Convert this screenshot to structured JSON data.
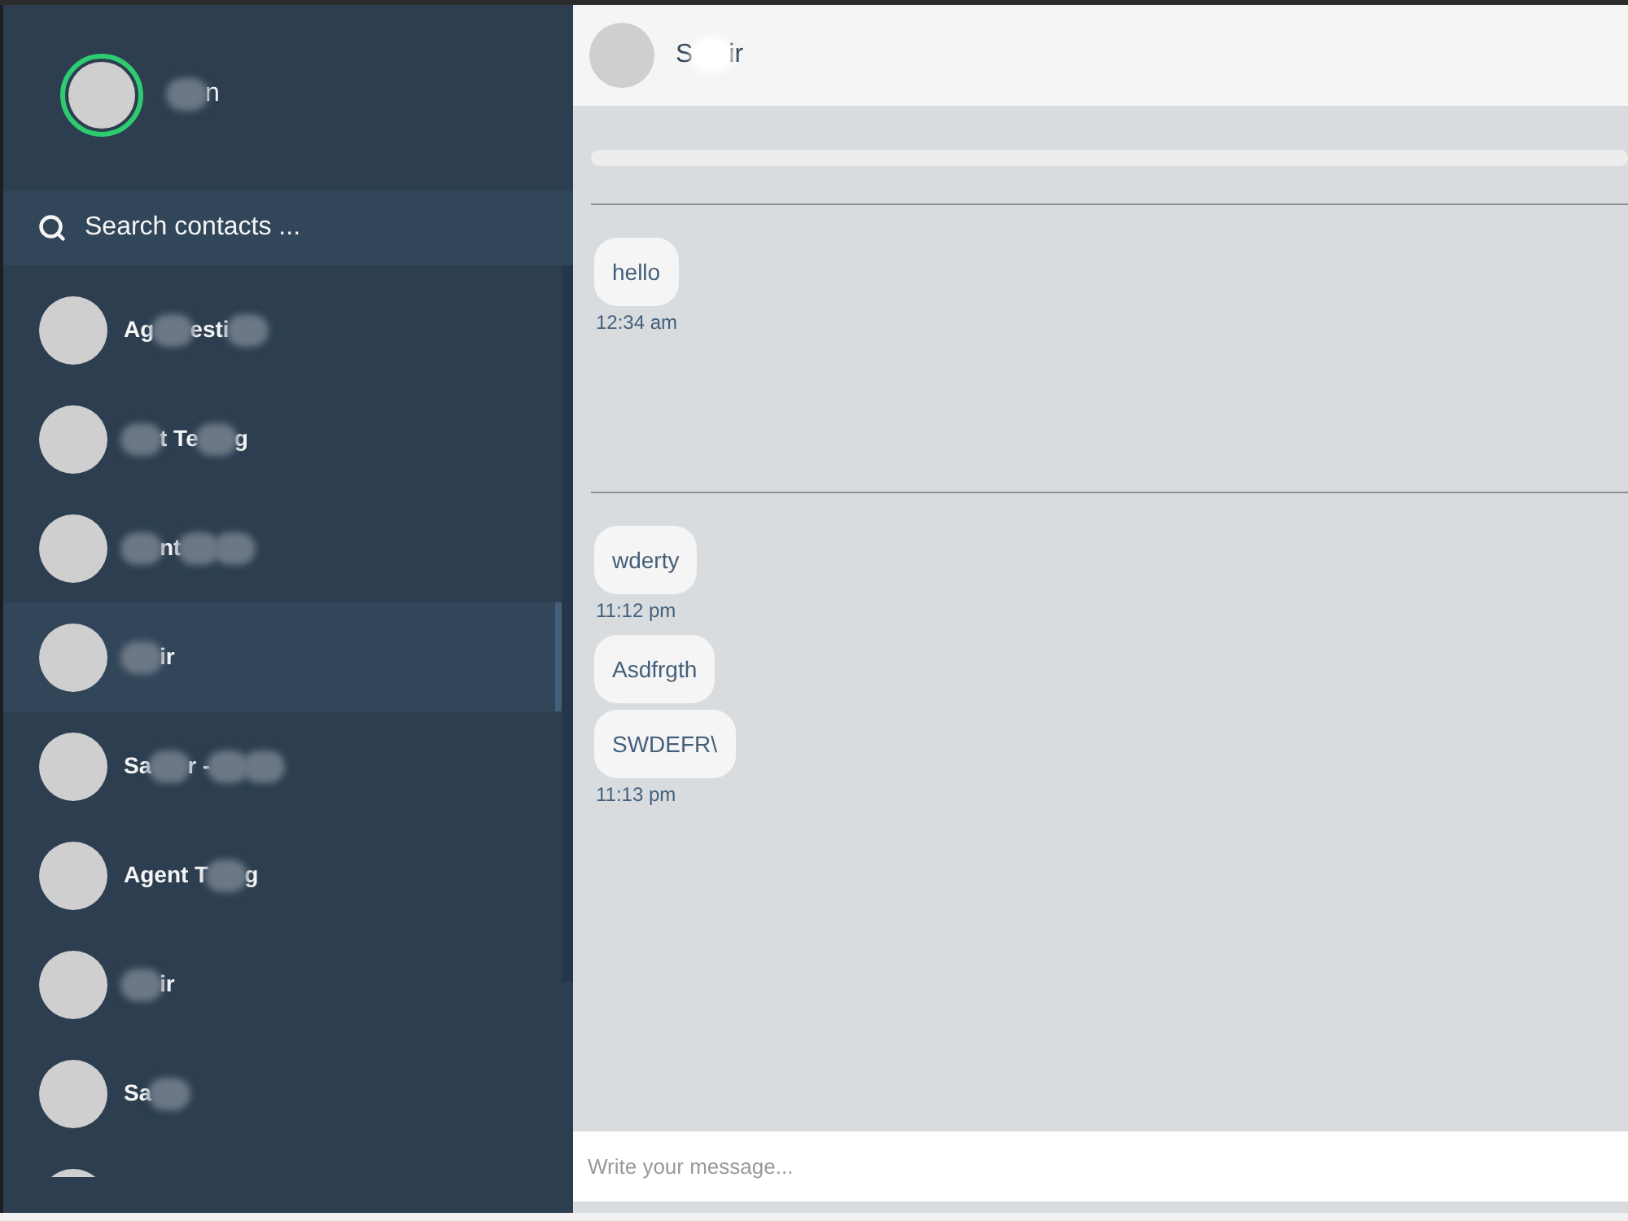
{
  "user": {
    "name": [
      {
        "kind": "blur"
      },
      {
        "kind": "text",
        "text": "n"
      }
    ]
  },
  "search": {
    "placeholder": "Search contacts ..."
  },
  "contacts": [
    {
      "selected": false,
      "name": [
        {
          "kind": "text",
          "text": "Ag"
        },
        {
          "kind": "blur"
        },
        {
          "kind": "text",
          "text": "esti"
        },
        {
          "kind": "blur"
        }
      ]
    },
    {
      "selected": false,
      "name": [
        {
          "kind": "blur"
        },
        {
          "kind": "text",
          "text": "t Te"
        },
        {
          "kind": "blur"
        },
        {
          "kind": "text",
          "text": "g"
        }
      ]
    },
    {
      "selected": false,
      "name": [
        {
          "kind": "blur"
        },
        {
          "kind": "text",
          "text": "nt"
        },
        {
          "kind": "blur"
        },
        {
          "kind": "blur"
        }
      ]
    },
    {
      "selected": true,
      "name": [
        {
          "kind": "blur"
        },
        {
          "kind": "text",
          "text": "ir"
        }
      ]
    },
    {
      "selected": false,
      "name": [
        {
          "kind": "text",
          "text": "Sa"
        },
        {
          "kind": "blur"
        },
        {
          "kind": "text",
          "text": "r -"
        },
        {
          "kind": "blur"
        },
        {
          "kind": "blur"
        }
      ]
    },
    {
      "selected": false,
      "name": [
        {
          "kind": "text",
          "text": "Agent T"
        },
        {
          "kind": "blur"
        },
        {
          "kind": "text",
          "text": "g"
        }
      ]
    },
    {
      "selected": false,
      "name": [
        {
          "kind": "blur"
        },
        {
          "kind": "text",
          "text": "ir"
        }
      ]
    },
    {
      "selected": false,
      "name": [
        {
          "kind": "text",
          "text": "Sa"
        },
        {
          "kind": "blur"
        }
      ]
    },
    {
      "selected": false
    }
  ],
  "chat": {
    "contact_name": [
      {
        "kind": "text",
        "text": "S"
      },
      {
        "kind": "blur"
      },
      {
        "kind": "text",
        "text": "ir"
      }
    ],
    "sections": [
      {
        "messages": [
          {
            "text": "hello",
            "time": "12:34 am"
          }
        ]
      },
      {
        "messages": [
          {
            "text": "wderty",
            "time": "11:12 pm"
          },
          {
            "text": "Asdfrgth"
          },
          {
            "text": "SWDEFR\\",
            "time": "11:13 pm"
          }
        ]
      }
    ]
  },
  "composer": {
    "placeholder": "Write your message..."
  }
}
